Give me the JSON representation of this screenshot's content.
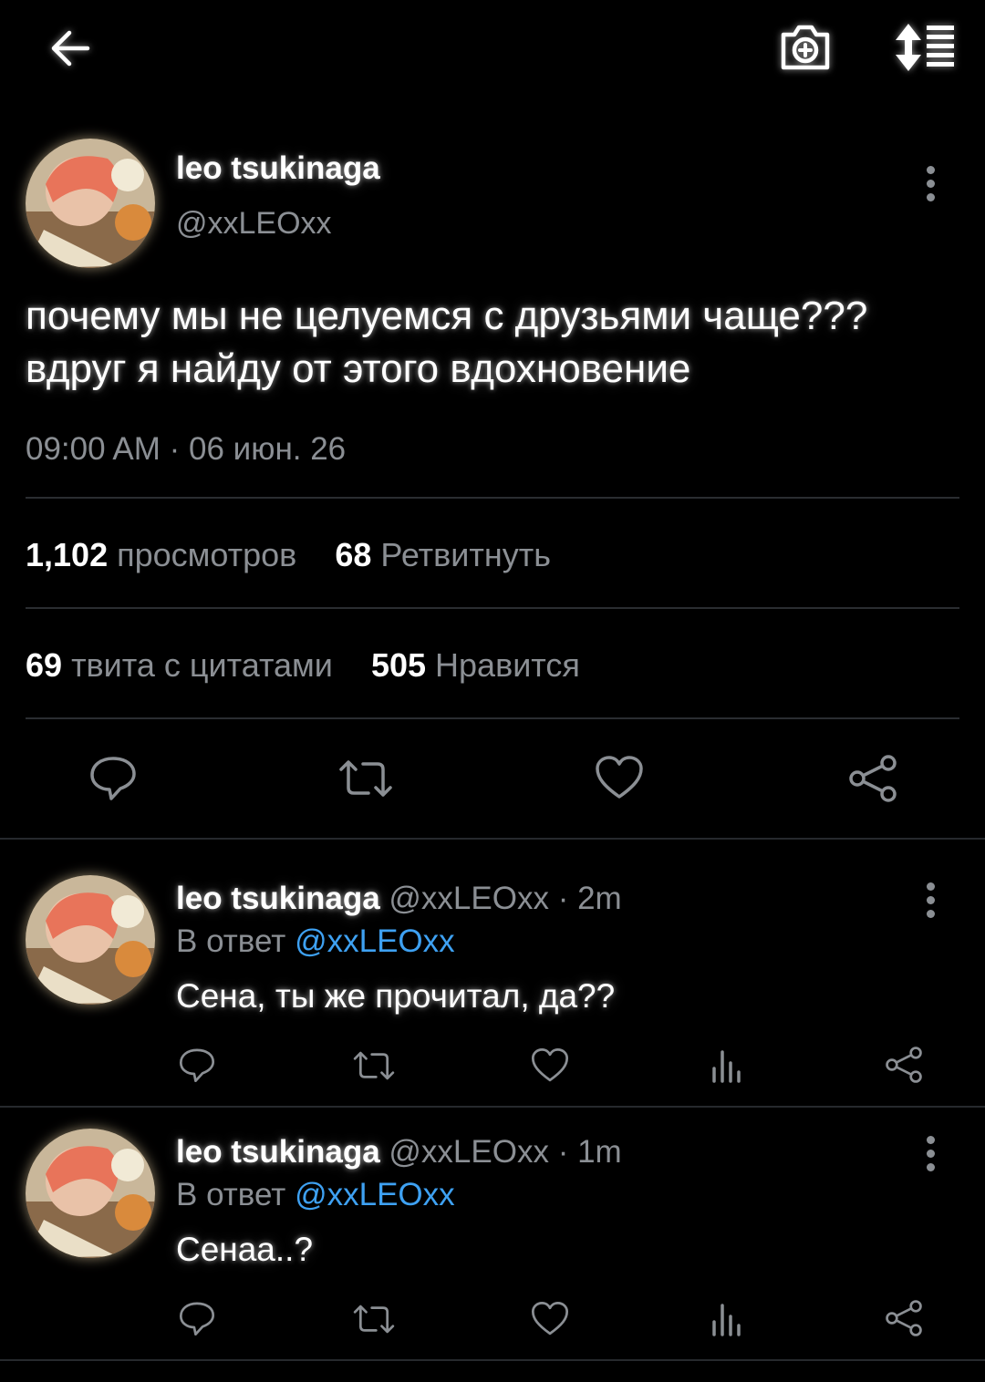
{
  "header": {
    "back_icon": "arrow-left-icon",
    "camera_icon": "camera-plus-icon",
    "sort_icon": "sort-list-icon"
  },
  "tweet": {
    "author_name": "leo tsukinaga",
    "author_handle": "@xxLEOxx",
    "text_line1": "почему мы не целуемся с друзьями чаще???",
    "text_line2": "вдруг я найду от этого вдохновение",
    "timestamp": "09:00 AM · 06 июн. 26",
    "views_count": "1,102",
    "views_label": "просмотров",
    "retweets_count": "68",
    "retweets_label": "Ретвитнуть",
    "quotes_count": "69",
    "quotes_label": "твита с цитатами",
    "likes_count": "505",
    "likes_label": "Нравится"
  },
  "replies": [
    {
      "author_name": "leo tsukinaga",
      "meta": "@xxLEOxx · 2m",
      "reply_prefix": "В ответ",
      "reply_handle": "@xxLEOxx",
      "text": "Сена, ты же прочитал, да??"
    },
    {
      "author_name": "leo tsukinaga",
      "meta": "@xxLEOxx · 1m",
      "reply_prefix": "В ответ",
      "reply_handle": "@xxLEOxx",
      "text": "Сенаа..?"
    }
  ],
  "colors": {
    "background": "#000000",
    "text": "#ffffff",
    "secondary": "#8b8f94",
    "link": "#3ea1f2"
  }
}
